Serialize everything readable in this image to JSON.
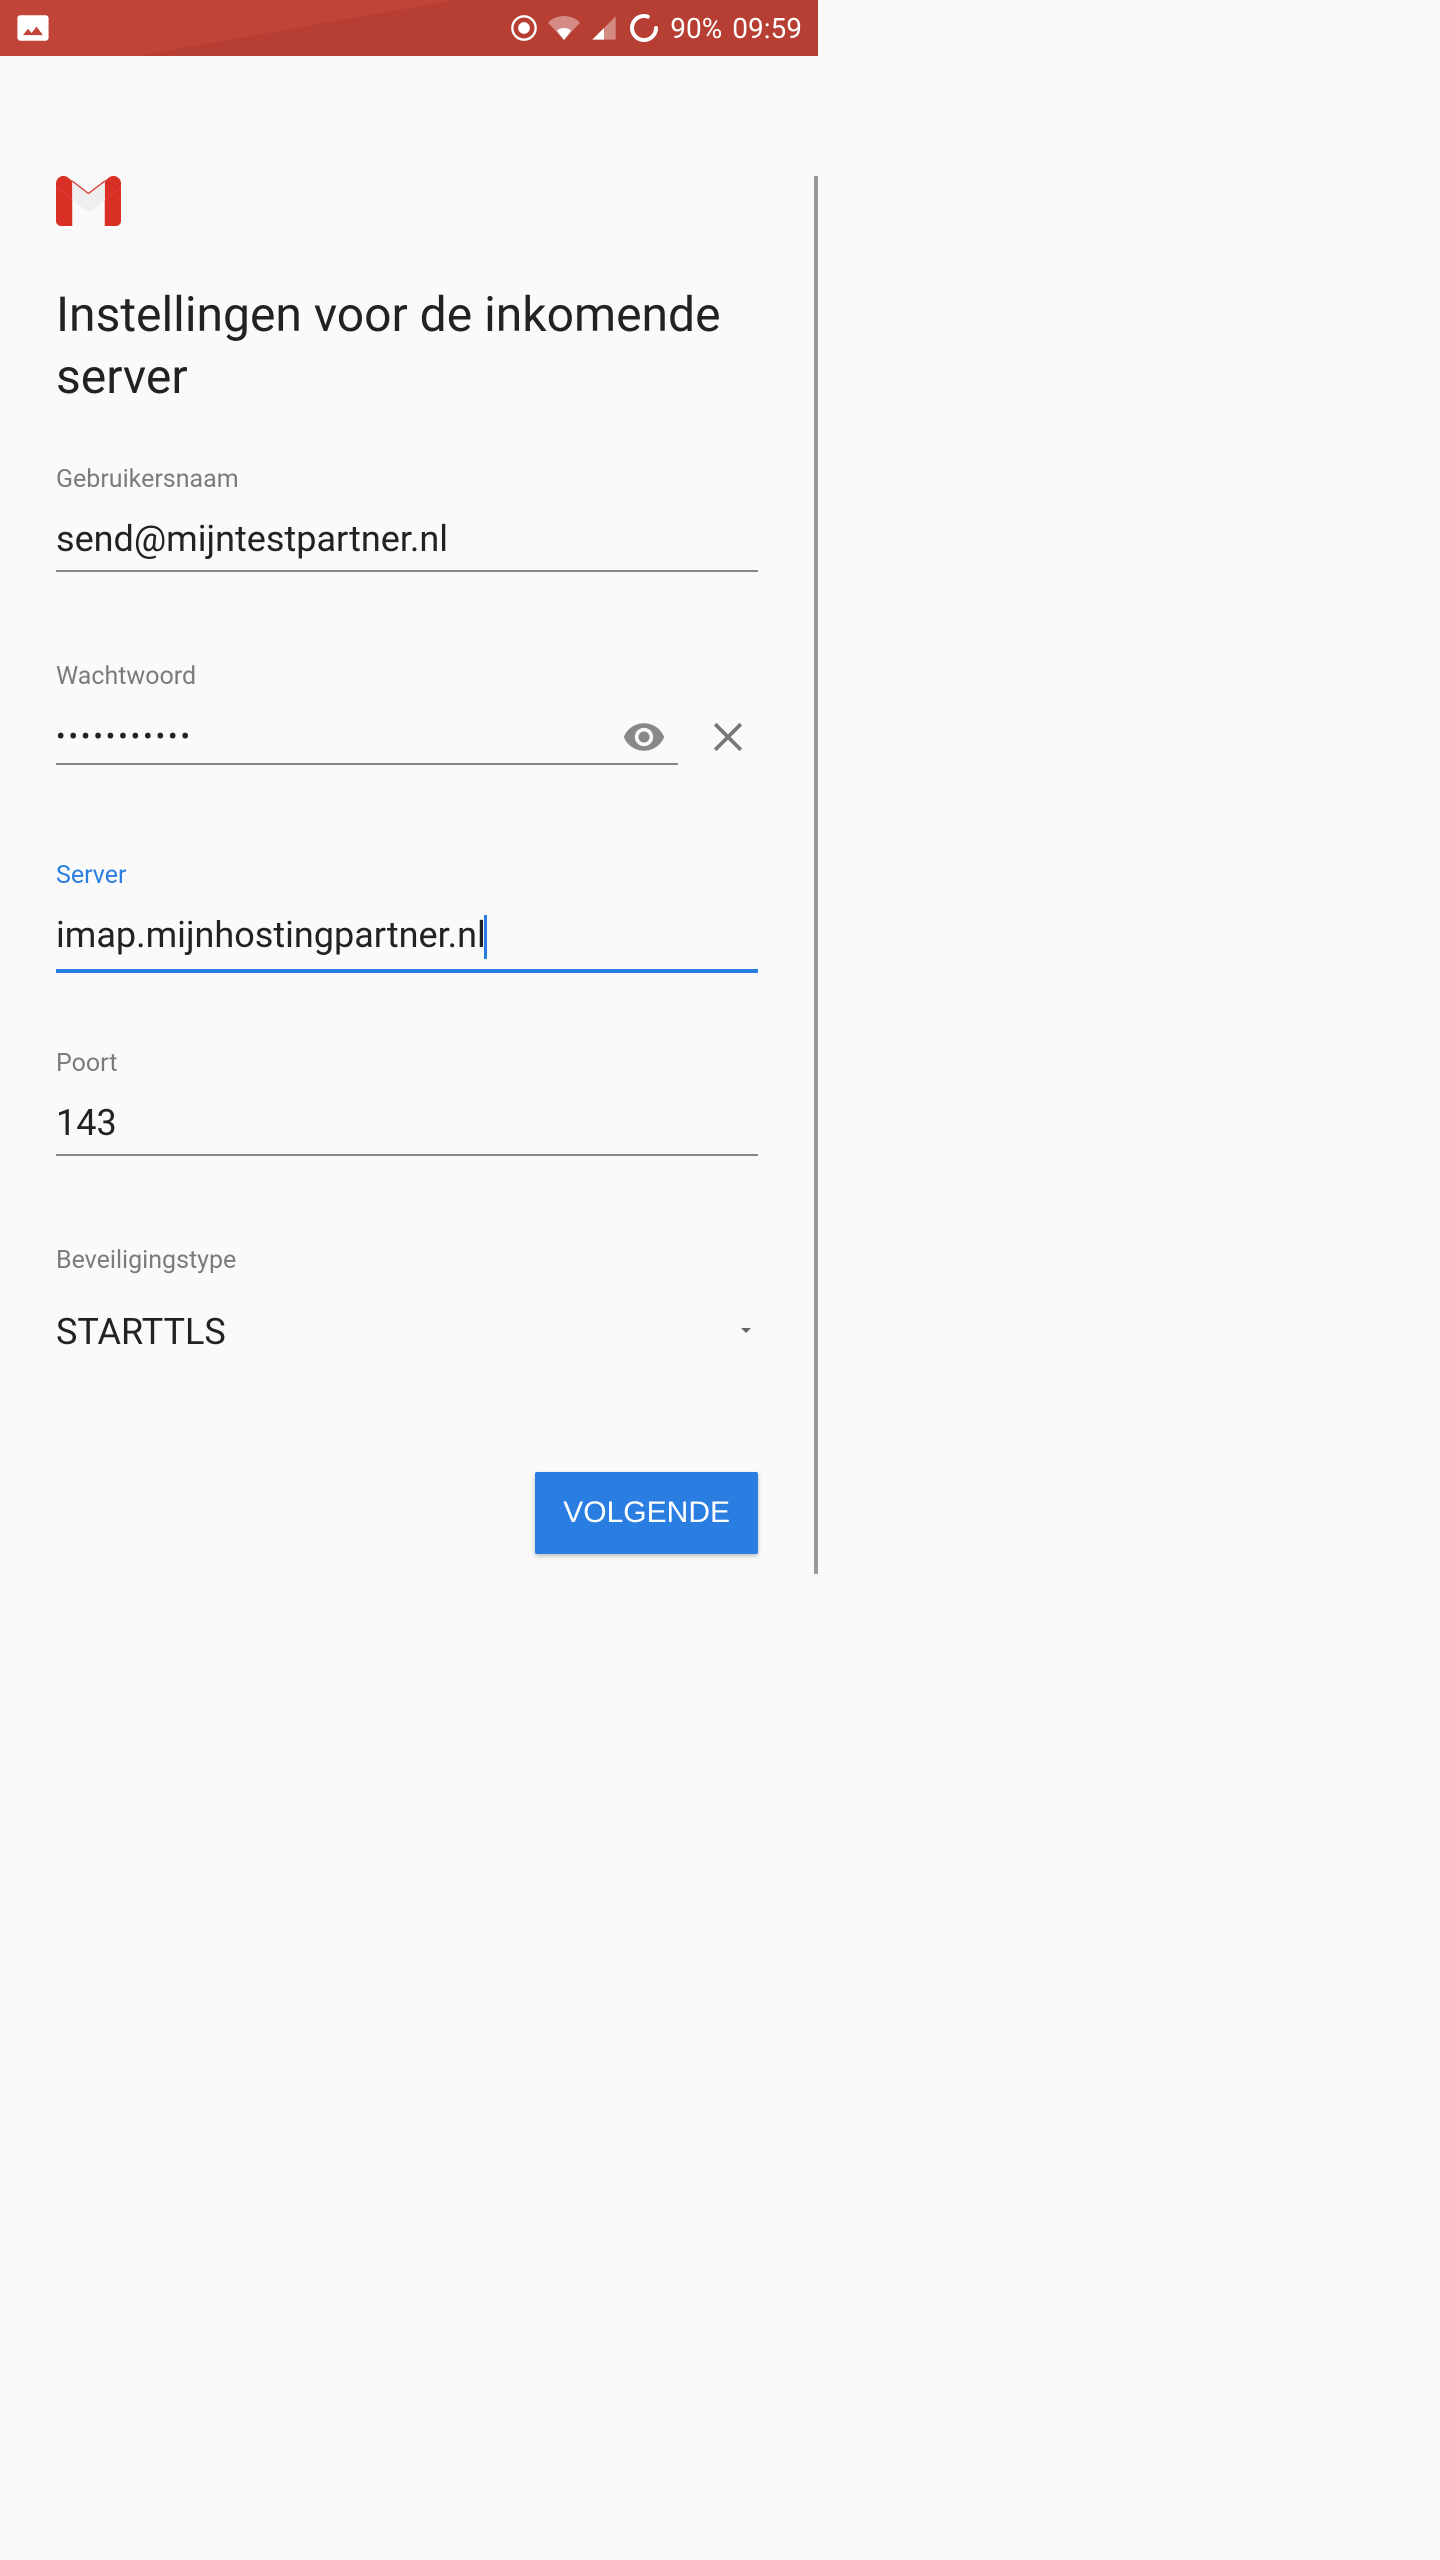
{
  "status_bar": {
    "battery_percent": "90%",
    "time": "09:59"
  },
  "page": {
    "title": "Instellingen voor de inkomende server"
  },
  "fields": {
    "username": {
      "label": "Gebruikersnaam",
      "value": "send@mijntestpartner.nl"
    },
    "password": {
      "label": "Wachtwoord",
      "value": "•••••••••••"
    },
    "server": {
      "label": "Server",
      "value": "imap.mijnhostingpartner.nl"
    },
    "port": {
      "label": "Poort",
      "value": "143"
    },
    "security": {
      "label": "Beveiligingstype",
      "value": "STARTTLS"
    }
  },
  "buttons": {
    "next": "VOLGENDE"
  }
}
